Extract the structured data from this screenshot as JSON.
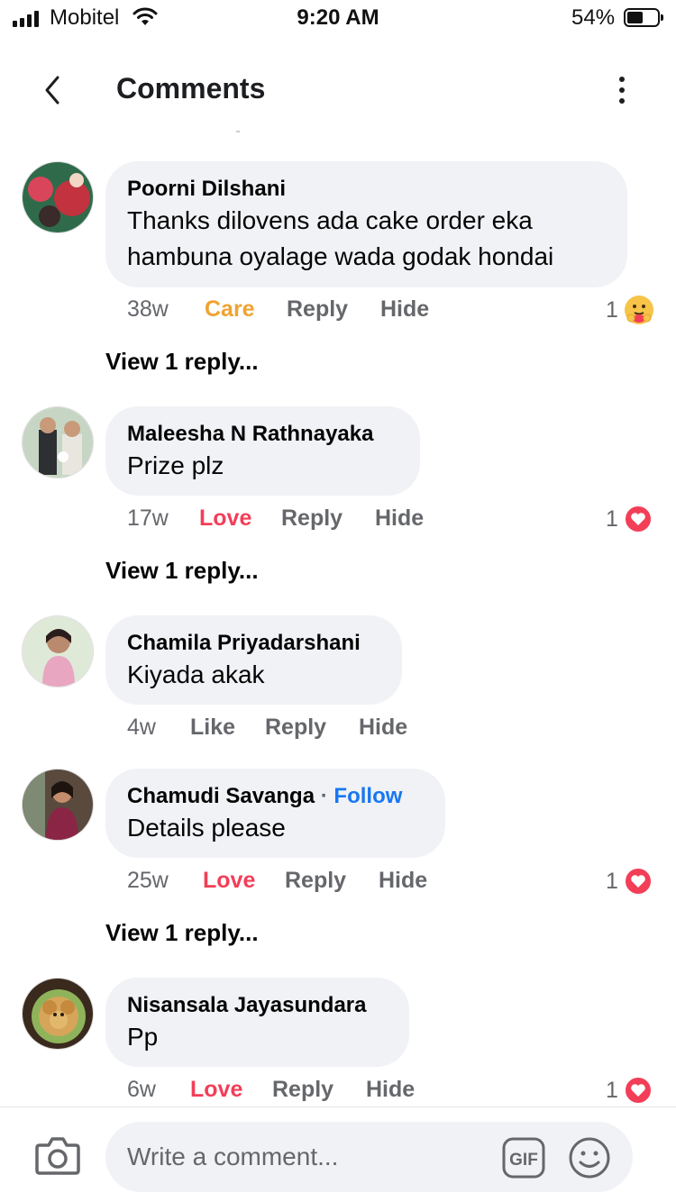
{
  "status_bar": {
    "carrier": "Mobitel",
    "time": "9:20 AM",
    "battery_percent": "54%",
    "battery_level": 0.54,
    "icons": [
      "signal-icon",
      "wifi-icon",
      "battery-icon"
    ]
  },
  "header": {
    "title": "Comments",
    "back_icon": "chevron-left-icon",
    "menu_icon": "more-vertical-icon"
  },
  "comments": [
    {
      "author": "Poorni Dilshani",
      "lines": [
        "Thanks dilovens   ada cake order  eka",
        "hambuna  oyalage wada  godak hondai"
      ],
      "time": "38w",
      "reaction_label": "Care",
      "reply_label": "Reply",
      "hide_label": "Hide",
      "reaction_count": "1",
      "reaction_icon": "care-emoji-icon",
      "view_replies": "View 1 reply..."
    },
    {
      "author": "Maleesha N Rathnayaka",
      "lines": [
        "Prize plz"
      ],
      "time": "17w",
      "reaction_label": "Love",
      "reply_label": "Reply",
      "hide_label": "Hide",
      "reaction_count": "1",
      "reaction_icon": "love-heart-icon",
      "view_replies": "View 1 reply..."
    },
    {
      "author": "Chamila Priyadarshani",
      "lines": [
        "Kiyada akak"
      ],
      "time": "4w",
      "reaction_label": "Like",
      "reply_label": "Reply",
      "hide_label": "Hide"
    },
    {
      "author": "Chamudi Savanga",
      "follow_separator": "·",
      "follow_label": "Follow",
      "lines": [
        "Details please"
      ],
      "time": "25w",
      "reaction_label": "Love",
      "reply_label": "Reply",
      "hide_label": "Hide",
      "reaction_count": "1",
      "reaction_icon": "love-heart-icon",
      "view_replies": "View 1 reply..."
    },
    {
      "author": "Nisansala Jayasundara",
      "lines": [
        "Pp"
      ],
      "time": "6w",
      "reaction_label": "Love",
      "reply_label": "Reply",
      "hide_label": "Hide",
      "reaction_count": "1",
      "reaction_icon": "love-heart-icon"
    }
  ],
  "composer": {
    "placeholder": "Write a comment...",
    "camera_icon": "camera-icon",
    "gif_icon": "gif-icon",
    "emoji_icon": "emoji-icon"
  },
  "colors": {
    "care": "#f0a330",
    "love": "#f33e58",
    "link": "#1877f2",
    "bubble": "#f0f2f5",
    "meta": "#65676b"
  }
}
